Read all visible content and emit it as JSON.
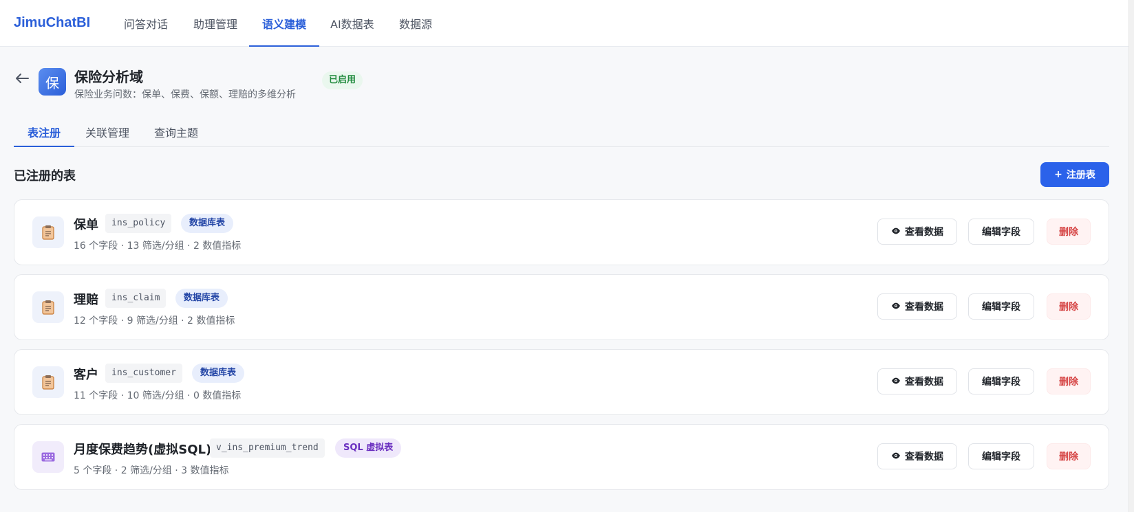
{
  "app": {
    "brand": "JimuChatBI"
  },
  "nav": {
    "items": [
      {
        "label": "问答对话"
      },
      {
        "label": "助理管理"
      },
      {
        "label": "语义建模",
        "active": true
      },
      {
        "label": "AI数据表"
      },
      {
        "label": "数据源"
      }
    ]
  },
  "domain": {
    "back_icon": "arrow-left-icon",
    "icon_text": "保",
    "title": "保险分析域",
    "description": "保险业务问数：保单、保费、保额、理赔的多维分析",
    "status": "已启用"
  },
  "tabs": [
    {
      "label": "表注册",
      "active": true
    },
    {
      "label": "关联管理"
    },
    {
      "label": "查询主题"
    }
  ],
  "section": {
    "title": "已注册的表",
    "register_button": "注册表",
    "register_icon": "plus-icon"
  },
  "actions": {
    "view": "查看数据",
    "view_icon": "eye-icon",
    "edit": "编辑字段",
    "delete": "删除"
  },
  "tables": [
    {
      "name": "保单",
      "code": "ins_policy",
      "type": "数据库表",
      "kind": "db",
      "icon": "clipboard-icon",
      "meta": "16 个字段 · 13 筛选/分组 · 2 数值指标"
    },
    {
      "name": "理赔",
      "code": "ins_claim",
      "type": "数据库表",
      "kind": "db",
      "icon": "clipboard-icon",
      "meta": "12 个字段 · 9 筛选/分组 · 2 数值指标"
    },
    {
      "name": "客户",
      "code": "ins_customer",
      "type": "数据库表",
      "kind": "db",
      "icon": "clipboard-icon",
      "meta": "11 个字段 · 10 筛选/分组 · 0 数值指标"
    },
    {
      "name": "月度保费趋势(虚拟SQL)",
      "code": "v_ins_premium_trend",
      "type": "SQL 虚拟表",
      "kind": "sql",
      "icon": "keyboard-icon",
      "meta": "5 个字段 · 2 筛选/分组 · 3 数值指标"
    }
  ],
  "colors": {
    "accent": "#2b5fd9",
    "button_primary": "#2b62ea",
    "status_green": "#1f8a3c",
    "danger": "#d64545",
    "sql_purple": "#6a2fc0"
  }
}
